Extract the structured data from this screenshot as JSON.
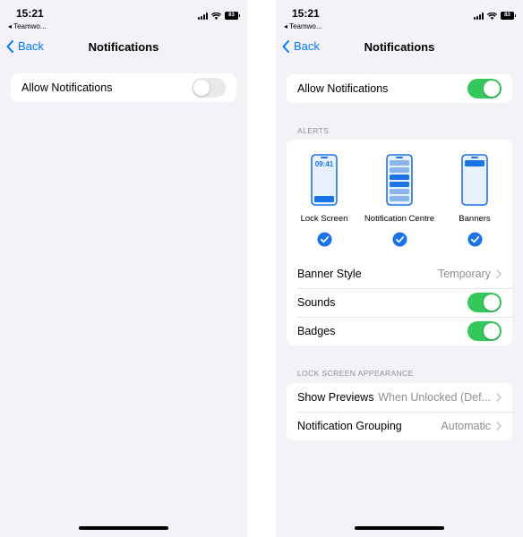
{
  "left_screen": {
    "status": {
      "time": "15:21",
      "back_app": "◂ Teamwo...",
      "battery": "83"
    },
    "nav": {
      "back_label": "Back",
      "title": "Notifications"
    },
    "allow_notifications": {
      "label": "Allow Notifications",
      "enabled": false
    }
  },
  "right_screen": {
    "status": {
      "time": "15:21",
      "back_app": "◂ Teamwo...",
      "battery": "83"
    },
    "nav": {
      "back_label": "Back",
      "title": "Notifications"
    },
    "allow_notifications": {
      "label": "Allow Notifications",
      "enabled": true
    },
    "alerts": {
      "header": "ALERTS",
      "styles": [
        {
          "label": "Lock Screen",
          "preview_time": "09:41",
          "checked": true
        },
        {
          "label": "Notification Centre",
          "checked": true
        },
        {
          "label": "Banners",
          "checked": true
        }
      ],
      "banner_style": {
        "label": "Banner Style",
        "value": "Temporary"
      },
      "sounds": {
        "label": "Sounds",
        "enabled": true
      },
      "badges": {
        "label": "Badges",
        "enabled": true
      }
    },
    "lock_screen_appearance": {
      "header": "LOCK SCREEN APPEARANCE",
      "show_previews": {
        "label": "Show Previews",
        "value": "When Unlocked (Def..."
      },
      "notification_grouping": {
        "label": "Notification Grouping",
        "value": "Automatic"
      }
    }
  },
  "colors": {
    "accent": "#007aff",
    "toggle_on": "#34c759",
    "toggle_off": "#e9e9eb",
    "background": "#f2f2f7"
  }
}
